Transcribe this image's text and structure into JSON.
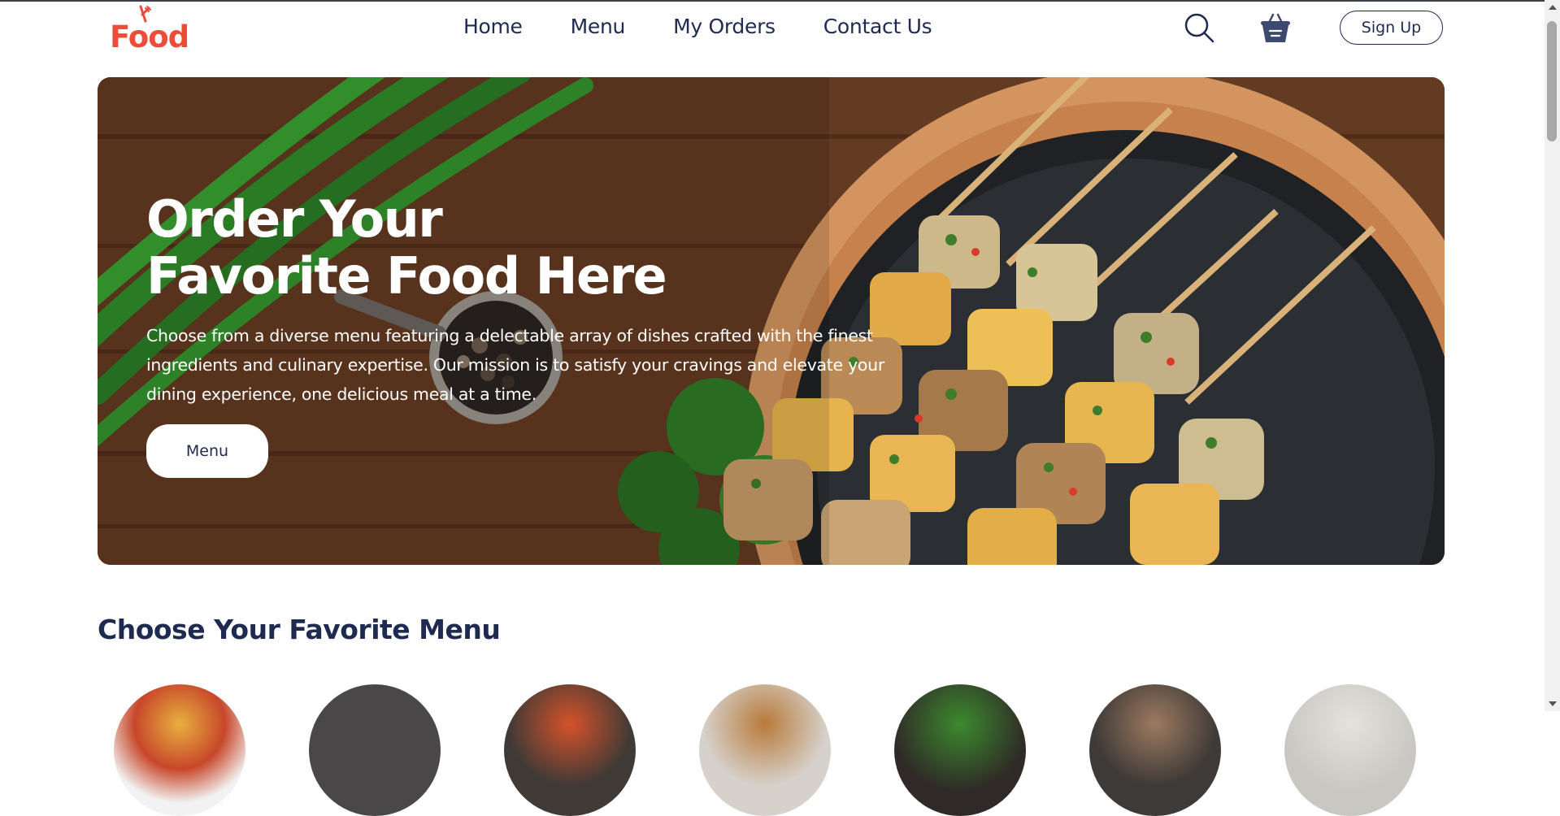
{
  "brand": {
    "logo_text": "Food",
    "accent": "#ee4b3a"
  },
  "nav": {
    "links": [
      "Home",
      "Menu",
      "My Orders",
      "Contact Us"
    ],
    "search_icon": "search-icon",
    "basket_icon": "basket-icon",
    "signup_label": "Sign Up"
  },
  "hero": {
    "title_line1": "Order Your",
    "title_line2": "Favorite Food Here",
    "text": "Choose from a diverse menu featuring a delectable array of dishes crafted with the finest ingredients and culinary expertise. Our mission is to satisfy your cravings and elevate your dining experience, one delicious meal at a time.",
    "button_label": "Menu"
  },
  "menu_section": {
    "title": "Choose Your Favorite Menu"
  },
  "colors": {
    "text_dark": "#1e2a4f",
    "hero_wood": "#5b3620"
  }
}
